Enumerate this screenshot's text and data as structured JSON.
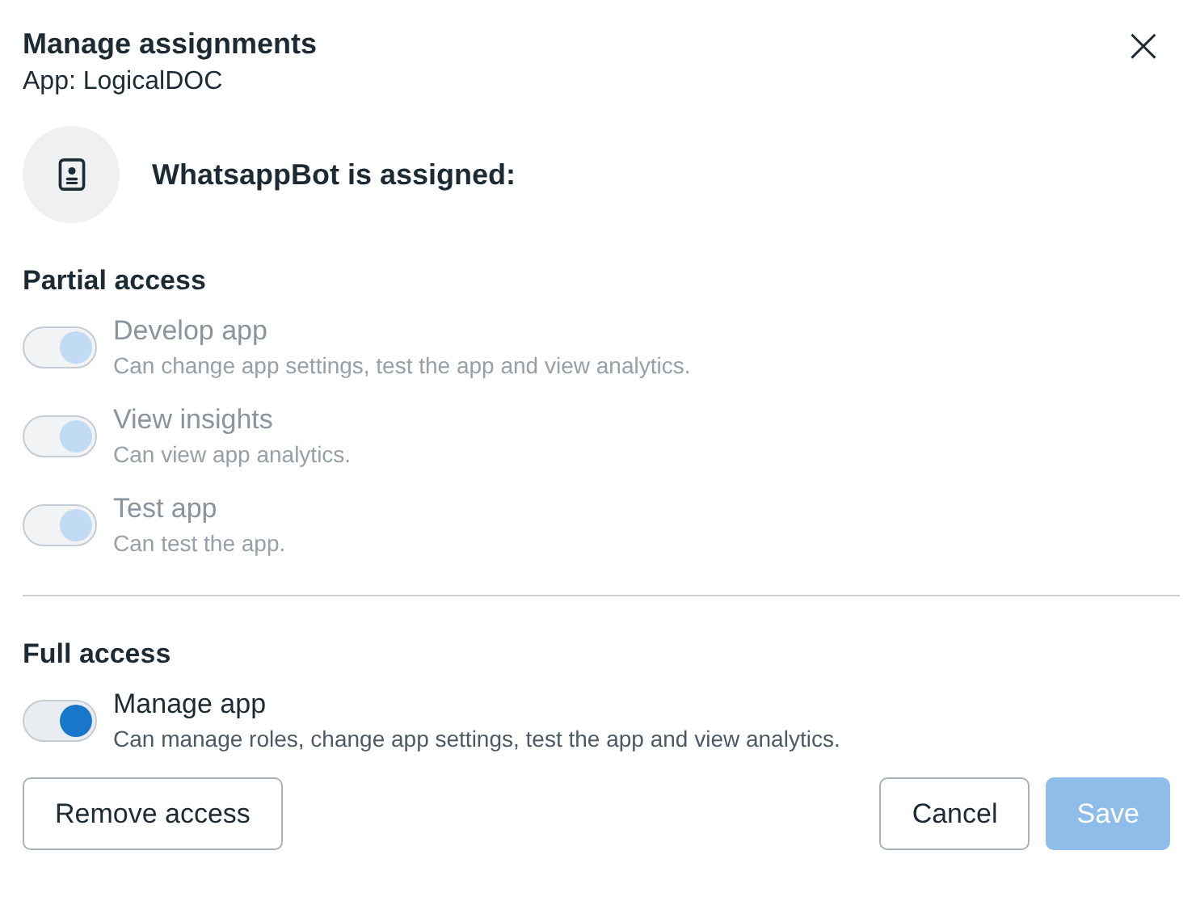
{
  "dialog": {
    "title": "Manage assignments",
    "subtitle": "App: LogicalDOC",
    "close": "×"
  },
  "assignee": {
    "text": "WhatsappBot is assigned:"
  },
  "sections": [
    {
      "heading": "Partial access",
      "permissions": [
        {
          "label": "Develop app",
          "description": "Can change app settings, test the app and view analytics.",
          "on": true,
          "disabled": true
        },
        {
          "label": "View insights",
          "description": "Can view app analytics.",
          "on": true,
          "disabled": true
        },
        {
          "label": "Test app",
          "description": "Can test the app.",
          "on": true,
          "disabled": true
        }
      ]
    },
    {
      "heading": "Full access",
      "permissions": [
        {
          "label": "Manage app",
          "description": "Can manage roles, change app settings, test the app and view analytics.",
          "on": true,
          "disabled": false
        }
      ]
    }
  ],
  "buttons": [
    {
      "label": "Remove access",
      "kind": "secondary",
      "disabled": false
    },
    {
      "label": "Cancel",
      "kind": "secondary",
      "disabled": false
    },
    {
      "label": "Save",
      "kind": "primary",
      "disabled": true
    }
  ]
}
